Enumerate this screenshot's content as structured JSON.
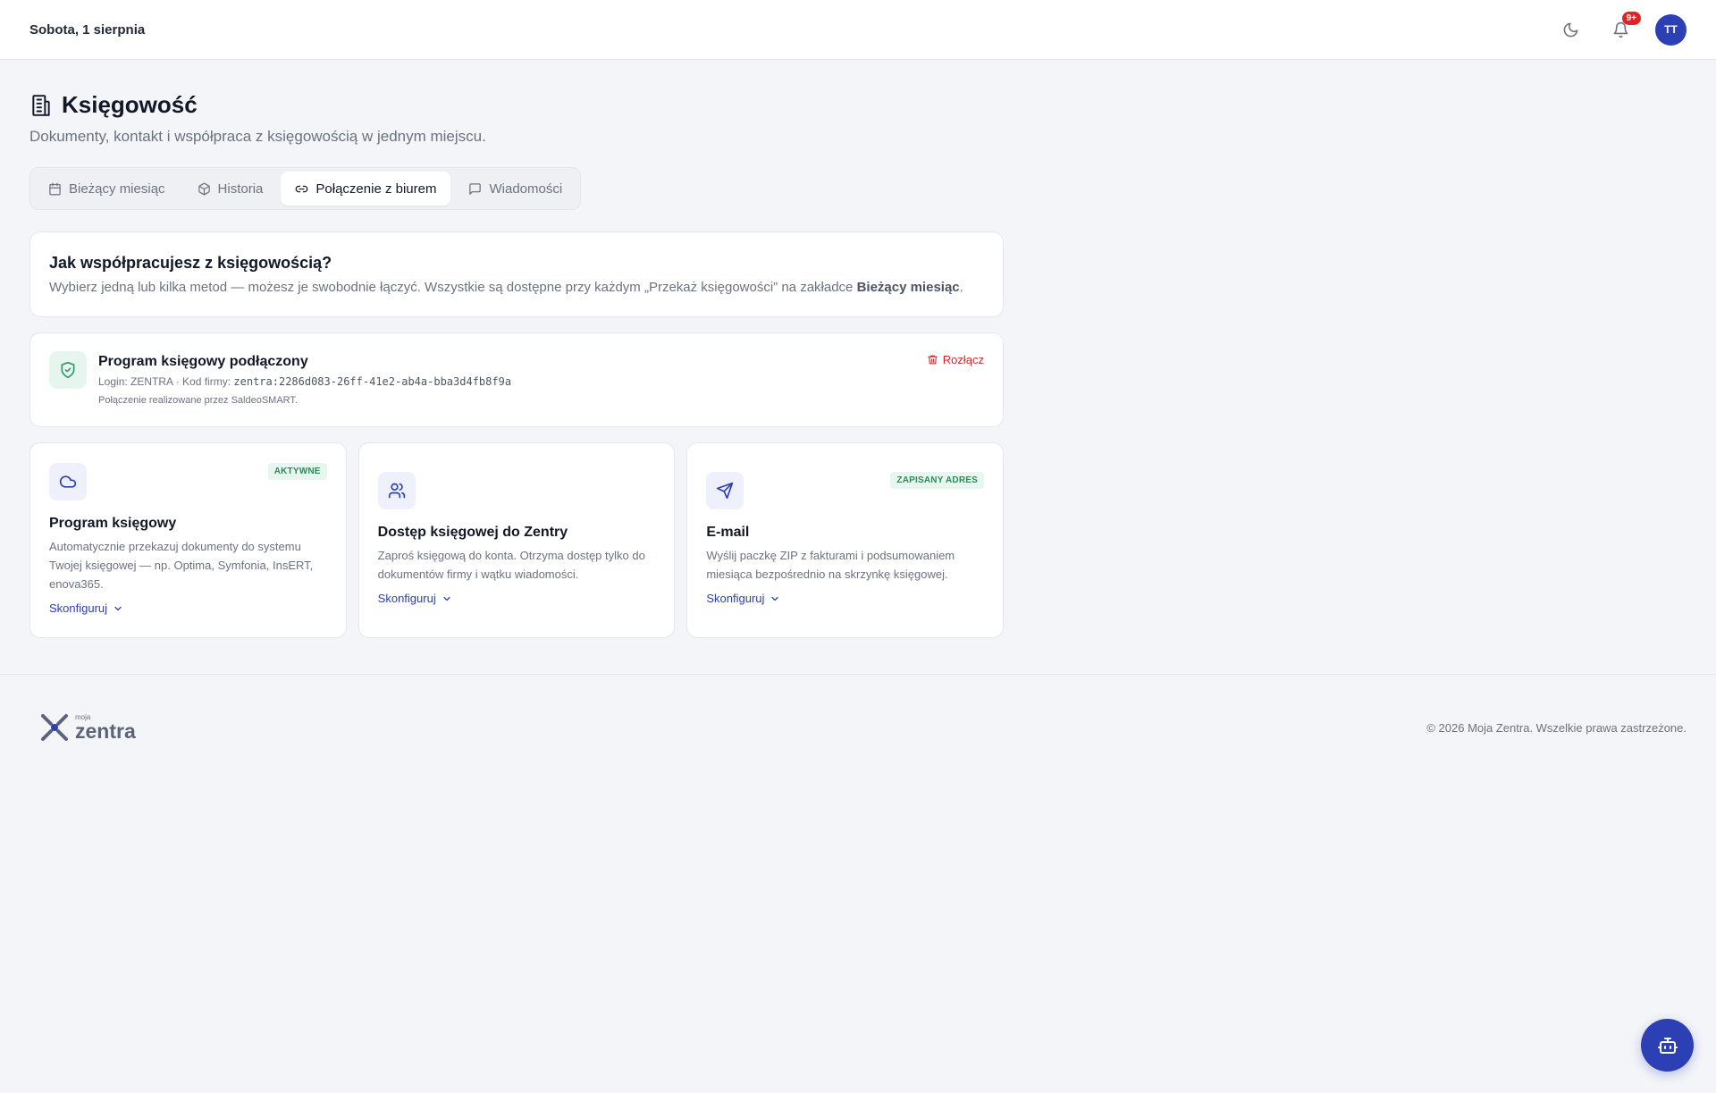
{
  "header": {
    "date": "Sobota, 1 sierpnia",
    "notification_badge": "9+",
    "avatar_initials": "TT"
  },
  "page": {
    "title": "Księgowość",
    "subtitle": "Dokumenty, kontakt i współpraca z księgowością w jednym miejscu."
  },
  "tabs": [
    {
      "label": "Bieżący miesiąc",
      "icon": "calendar-icon",
      "active": false
    },
    {
      "label": "Historia",
      "icon": "box-icon",
      "active": false
    },
    {
      "label": "Połączenie z biurem",
      "icon": "link-icon",
      "active": true
    },
    {
      "label": "Wiadomości",
      "icon": "message-icon",
      "active": false
    }
  ],
  "intro": {
    "title": "Jak współpracujesz z księgowością?",
    "desc_prefix": "Wybierz jedną lub kilka metod — możesz je swobodnie łączyć. Wszystkie są dostępne przy każdym „Przekaż księgowości” na zakładce ",
    "desc_bold": "Bieżący miesiąc",
    "desc_suffix": "."
  },
  "connection": {
    "title": "Program księgowy podłączony",
    "login_prefix": "Login: ZENTRA · Kod firmy: ",
    "company_code": "zentra:2286d083-26ff-41e2-ab4a-bba3d4fb8f9a",
    "note": "Połączenie realizowane przez SaldeoSMART.",
    "disconnect_label": "Rozłącz"
  },
  "methods": [
    {
      "title": "Program księgowy",
      "desc": "Automatycznie przekazuj dokumenty do systemu Twojej księgowej — np. Optima, Symfonia, InsERT, enova365.",
      "badge": "AKTYWNE",
      "configure_label": "Skonfiguruj",
      "icon": "cloud-icon"
    },
    {
      "title": "Dostęp księgowej do Zentry",
      "desc": "Zaproś księgową do konta. Otrzyma dostęp tylko do dokumentów firmy i wątku wiadomości.",
      "badge": "",
      "configure_label": "Skonfiguruj",
      "icon": "users-icon"
    },
    {
      "title": "E-mail",
      "desc": "Wyślij paczkę ZIP z fakturami i podsumowaniem miesiąca bezpośrednio na skrzynkę księgowej.",
      "badge": "ZAPISANY ADRES",
      "configure_label": "Skonfiguruj",
      "icon": "send-icon"
    }
  ],
  "footer": {
    "logo_small": "moja",
    "logo_big": "zentra",
    "copyright": "© 2026 Moja Zentra. Wszelkie prawa zastrzeżone."
  },
  "colors": {
    "accent": "#2c3fb5",
    "danger": "#dc2626",
    "success": "#2e8b57"
  }
}
